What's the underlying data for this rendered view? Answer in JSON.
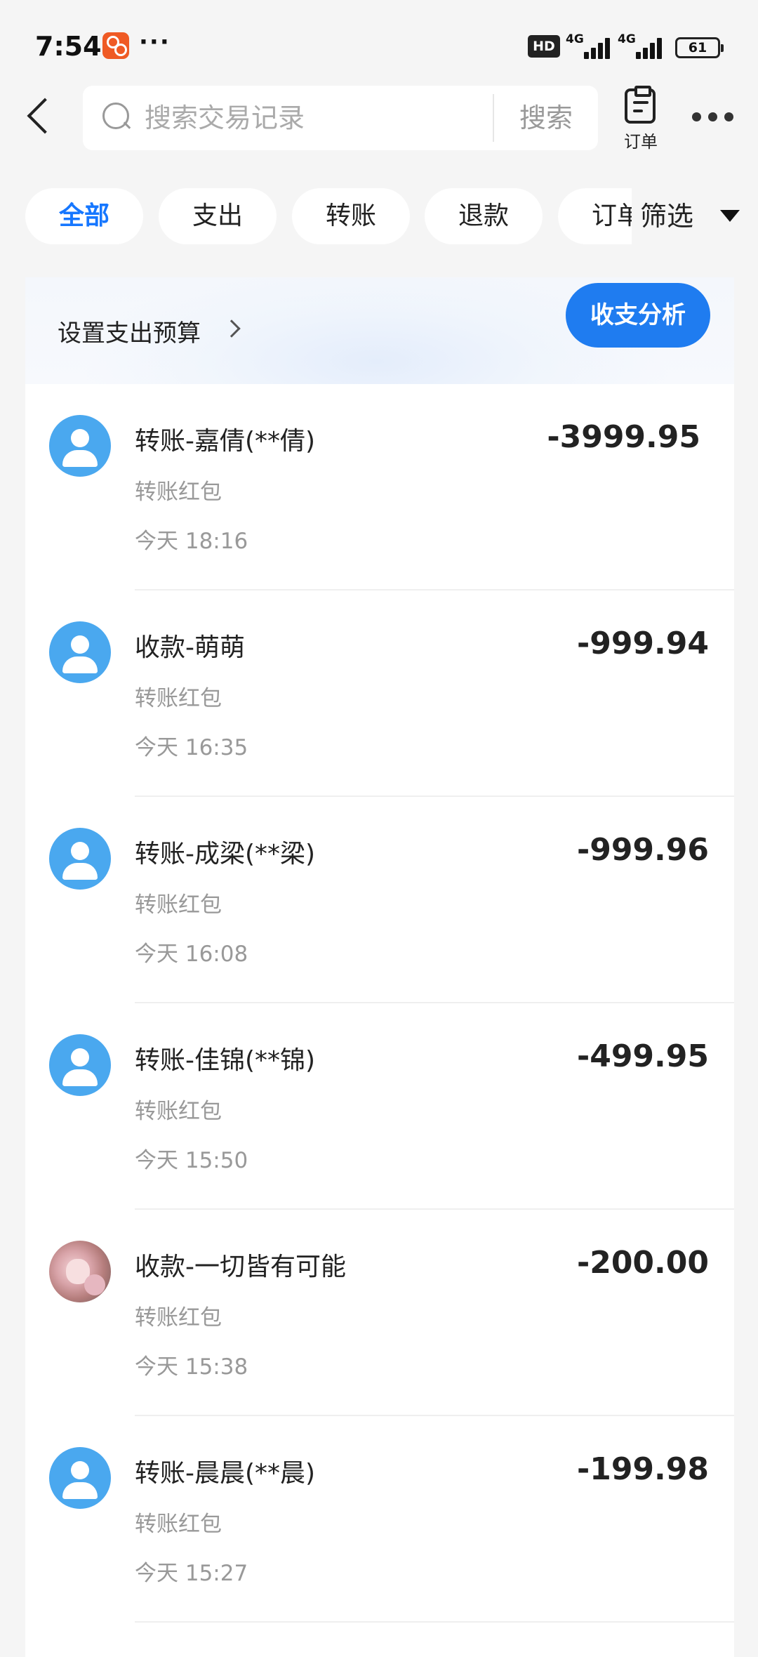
{
  "status_bar": {
    "time": "7:54",
    "dots": "···",
    "hd": "HD",
    "network_1": "4G",
    "network_2": "4G",
    "battery": "61"
  },
  "header": {
    "search_placeholder": "搜索交易记录",
    "search_button": "搜索",
    "order_label": "订单"
  },
  "tabs": [
    {
      "label": "全部",
      "active": true
    },
    {
      "label": "支出",
      "active": false
    },
    {
      "label": "转账",
      "active": false
    },
    {
      "label": "退款",
      "active": false
    },
    {
      "label": "订单",
      "active": false
    }
  ],
  "filter_label": "筛选",
  "budget": {
    "link_label": "设置支出预算",
    "analysis_button": "收支分析"
  },
  "transactions": [
    {
      "title": "转账-嘉倩(**倩)",
      "subtitle": "转账红包",
      "time": "今天 18:16",
      "amount": "-3999.95",
      "avatar": "default"
    },
    {
      "title": "收款-萌萌",
      "subtitle": "转账红包",
      "time": "今天 16:35",
      "amount": "-999.94",
      "avatar": "default"
    },
    {
      "title": "转账-成梁(**梁)",
      "subtitle": "转账红包",
      "time": "今天 16:08",
      "amount": "-999.96",
      "avatar": "default"
    },
    {
      "title": "转账-佳锦(**锦)",
      "subtitle": "转账红包",
      "time": "今天 15:50",
      "amount": "-499.95",
      "avatar": "default"
    },
    {
      "title": "收款-一切皆有可能",
      "subtitle": "转账红包",
      "time": "今天 15:38",
      "amount": "-200.00",
      "avatar": "photo"
    },
    {
      "title": "转账-晨晨(**晨)",
      "subtitle": "转账红包",
      "time": "今天 15:27",
      "amount": "-199.98",
      "avatar": "default"
    }
  ],
  "colors": {
    "accent": "#1677ff",
    "button_blue": "#1f7cf0",
    "avatar_blue": "#4aa8ef",
    "background": "#f5f5f5"
  }
}
